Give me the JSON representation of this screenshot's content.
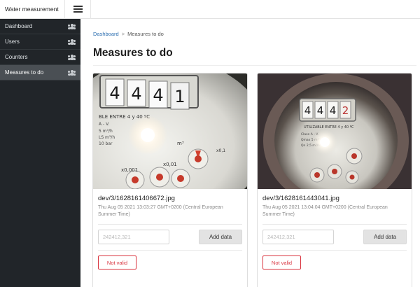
{
  "app": {
    "title": "Water measurement"
  },
  "sidebar": {
    "items": [
      {
        "label": "Dashboard",
        "icon": "users-icon",
        "active": false
      },
      {
        "label": "Users",
        "icon": "users-icon",
        "active": false
      },
      {
        "label": "Counters",
        "icon": "users-icon",
        "active": false
      },
      {
        "label": "Measures to do",
        "icon": "users-icon",
        "active": true
      }
    ]
  },
  "breadcrumb": {
    "home": "Dashboard",
    "separator": ">",
    "current": "Measures to do"
  },
  "page": {
    "title": "Measures to do"
  },
  "cards": [
    {
      "filename": "dev/3/1628161406672.jpg",
      "date": "Thu Aug 05 2021 13:03:27 GMT+0200 (Central European Summer Time)",
      "input_placeholder": "242412,321",
      "add_label": "Add data",
      "invalid_label": "Not valid",
      "photo_digits": [
        "4",
        "4",
        "4",
        "1"
      ]
    },
    {
      "filename": "dev/3/1628161443041.jpg",
      "date": "Thu Aug 05 2021 13:04:04 GMT+0200 (Central European Summer Time)",
      "input_placeholder": "242412,321",
      "add_label": "Add data",
      "invalid_label": "Not valid",
      "photo_digits": [
        "4",
        "4",
        "4",
        "2"
      ]
    }
  ],
  "colors": {
    "sidebar_bg": "#212529",
    "sidebar_active": "#4a4f54",
    "link": "#2a6db0",
    "danger": "#d9343f"
  }
}
